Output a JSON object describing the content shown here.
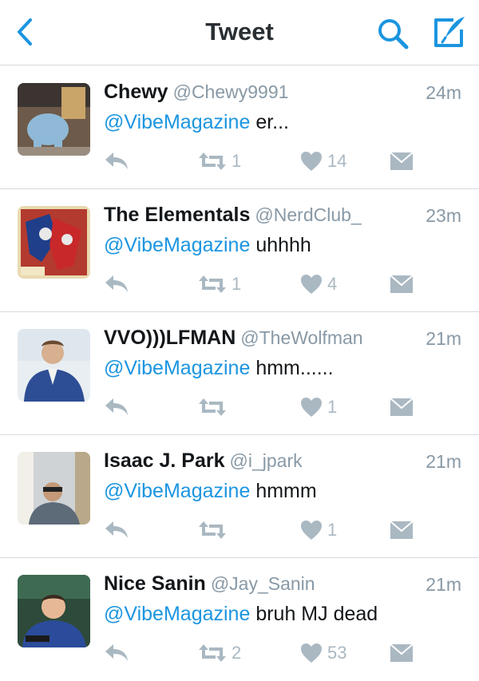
{
  "header": {
    "title": "Tweet",
    "back_icon": "chevron-left-icon",
    "search_icon": "search-icon",
    "compose_icon": "compose-icon",
    "accent_color": "#1b95e0"
  },
  "tweets": [
    {
      "name": "Chewy",
      "handle": "@Chewy9991",
      "time": "24m",
      "mention": "@VibeMagazine",
      "text": " er...",
      "retweets": "1",
      "likes": "14"
    },
    {
      "name": "The Elementals",
      "handle": "@NerdClub_",
      "time": "23m",
      "mention": "@VibeMagazine",
      "text": " uhhhh",
      "retweets": "1",
      "likes": "4"
    },
    {
      "name": "VVO)))LFMAN",
      "handle": "@TheWolfman",
      "time": "21m",
      "mention": "@VibeMagazine",
      "text": " hmm......",
      "retweets": "",
      "likes": "1"
    },
    {
      "name": "Isaac J. Park",
      "handle": "@i_jpark",
      "time": "21m",
      "mention": "@VibeMagazine",
      "text": " hmmm",
      "retweets": "",
      "likes": "1"
    },
    {
      "name": "Nice Sanin",
      "handle": "@Jay_Sanin",
      "time": "21m",
      "mention": "@VibeMagazine",
      "text": " bruh MJ dead",
      "retweets": "2",
      "likes": "53"
    }
  ]
}
